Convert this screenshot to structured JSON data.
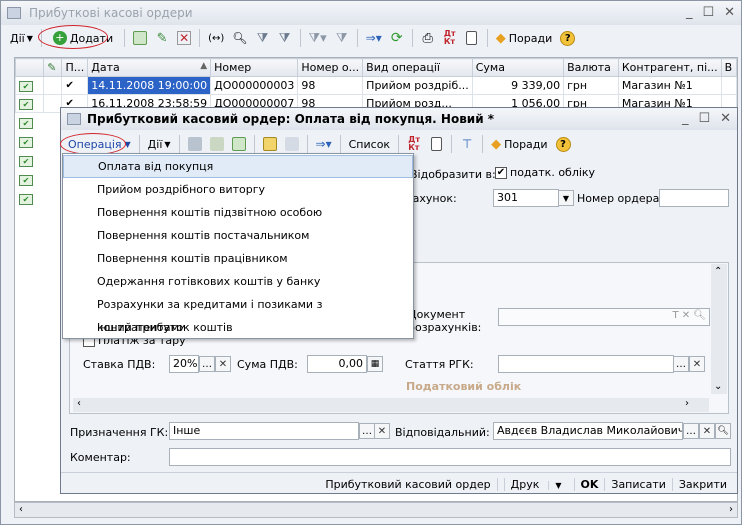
{
  "back_window": {
    "title": "Прибуткові касові ордери",
    "actions_label": "Дії",
    "add_label": "Додати",
    "tips_label": "Поради",
    "columns": [
      "",
      "П...",
      "Дата",
      "Номер",
      "Номер о...",
      "Вид операції",
      "Сума",
      "Валюта",
      "Контрагент, пі...",
      "В"
    ],
    "rows": [
      {
        "posted": "✔",
        "date": "14.11.2008 19:00:00",
        "number": "ДО000000003",
        "num_o": "98",
        "op": "Прийом роздріб...",
        "sum": "9 339,00",
        "cur": "грн",
        "contractor": "Магазин №1"
      },
      {
        "posted": "✔",
        "date": "16.11.2008 23:58:59",
        "number": "ДО000000007",
        "num_o": "98",
        "op": "Прийом розд...",
        "sum": "1 056,00",
        "cur": "грн",
        "contractor": "Магазин №1"
      }
    ]
  },
  "form": {
    "title": "Прибутковий касовий ордер: Оплата від покупця. Новий *",
    "operation_label": "Операція",
    "actions_label": "Дії",
    "list_label": "Список",
    "tips_label": "Поради",
    "reflect_label": "Відобразити в:",
    "tax_check_label": "податк. обліку",
    "account_label": "Рахунок:",
    "account_value": "301",
    "order_number_label": "Номер ордера:",
    "doc_settlements_label": "Документ розрахунків:",
    "packaging_label": "Платіж за тару",
    "vat_rate_label": "Ставка ПДВ:",
    "vat_rate_value": "20%",
    "vat_sum_label": "Сума ПДВ:",
    "vat_sum_value": "0,00",
    "rgk_label": "Стаття РГК:",
    "tax_accounting_label": "Податковий облік",
    "purpose_label": "Призначення ГК:",
    "purpose_value": "Інше",
    "responsible_label": "Відповідальний:",
    "responsible_value": "Авдєєв Владислав Миколайович",
    "comment_label": "Коментар:",
    "comment_value": "",
    "bottom": {
      "print_form": "Прибутковий касовий ордер",
      "print": "Друк",
      "ok": "OK",
      "save": "Записати",
      "close": "Закрити"
    }
  },
  "operation_menu": [
    "Оплата від покупця",
    "Прийом роздрібного виторгу",
    "Повернення коштів підзвітною особою",
    "Повернення коштів постачальником",
    "Повернення коштів працівником",
    "Одержання готівкових коштів у банку",
    "Розрахунки за кредитами і позиками з контрагентами",
    "Інший прибуток коштів"
  ],
  "colors": {
    "selected_row": "#2b63c6",
    "highlight_oval": "#d0232a",
    "menu_hover": "#e1ebf7",
    "accent_orange": "#e8a020",
    "green": "#36a03a"
  }
}
